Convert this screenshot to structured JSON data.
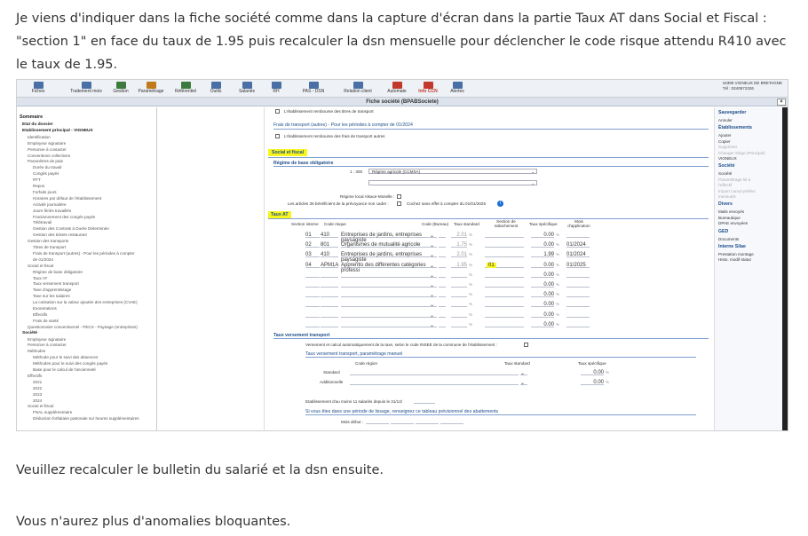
{
  "message": {
    "p1": "Je viens d'indiquer dans la fiche société comme  dans la capture d'écran dans la partie Taux AT dans Social et Fiscal : \"section 1\" en face du taux de 1.95 puis recalculer la dsn mensuelle pour déclencher le code risque attendu R410 avec le taux de 1.95.",
    "p2": "Veuillez recalculer le bulletin du salarié et la dsn ensuite.",
    "p3": "Vous n'aurez plus d'anomalies bloquantes."
  },
  "colors": {
    "highlight": "#f6f51d",
    "section_blue": "#1f4e8c",
    "toolbar_bg": "#eef1f5"
  },
  "toolbar": {
    "items": [
      {
        "label": "Fiches",
        "icon": "cards-icon"
      },
      {
        "label": "Traitement mois",
        "icon": "wrench-icon"
      },
      {
        "label": "Gestion",
        "icon": "folder-icon"
      },
      {
        "label": "Paramétrage",
        "icon": "gear-icon"
      },
      {
        "label": "Référentiel",
        "icon": "book-icon"
      },
      {
        "label": "Outils",
        "icon": "tools-icon"
      },
      {
        "label": "Salariés",
        "icon": "people-icon"
      },
      {
        "label": "RH",
        "icon": "rh-icon"
      },
      {
        "label": "PAS - DSN",
        "icon": "dsn-icon"
      },
      {
        "label": "Relation client",
        "icon": "headset-icon"
      },
      {
        "label": "Automate",
        "icon": "robot-icon"
      },
      {
        "label": "Info CCN",
        "icon": "info-icon"
      },
      {
        "label": "Alertes",
        "icon": "bell-icon"
      }
    ],
    "address": [
      "44390 VIGNEUX DE BRETAGNE",
      "Tél : 0240572326"
    ]
  },
  "window_title": "Fiche société (BPABSociete)",
  "left_nav": {
    "title": "Sommaire",
    "items": [
      {
        "t": "Etat du dossier",
        "lvl": 1
      },
      {
        "t": "Etablissement principal - VIGNEUX",
        "lvl": 1
      },
      {
        "t": "Identification",
        "lvl": 2
      },
      {
        "t": "Employeur signataire",
        "lvl": 2
      },
      {
        "t": "Personne à contacter",
        "lvl": 2
      },
      {
        "t": "Conventions collectives",
        "lvl": 2
      },
      {
        "t": "Paramètres de paie",
        "lvl": 2
      },
      {
        "t": "Durée du travail",
        "lvl": 3
      },
      {
        "t": "Congés payés",
        "lvl": 3
      },
      {
        "t": "RTT",
        "lvl": 3
      },
      {
        "t": "Repos",
        "lvl": 3
      },
      {
        "t": "Forfaits jours",
        "lvl": 3
      },
      {
        "t": "Horaires par défaut de l'établissement",
        "lvl": 3
      },
      {
        "t": "Activité journalière",
        "lvl": 3
      },
      {
        "t": "Jours fériés travaillés",
        "lvl": 3
      },
      {
        "t": "Fractionnement des congés payés",
        "lvl": 3
      },
      {
        "t": "Télétravail",
        "lvl": 3
      },
      {
        "t": "Gestion des Contrats à Durée Déterminée",
        "lvl": 3
      },
      {
        "t": "Gestion des tickets restaurant",
        "lvl": 3
      },
      {
        "t": "Gestion des transports",
        "lvl": 2
      },
      {
        "t": "Titres de transport",
        "lvl": 3
      },
      {
        "t": "Frais de transport (autres) - Pour les périodes à compter",
        "lvl": 3
      },
      {
        "t": "de 01/2024",
        "lvl": 3
      },
      {
        "t": "Social et fiscal",
        "lvl": 2
      },
      {
        "t": "Régime de base obligatoire",
        "lvl": 3
      },
      {
        "t": "Taux AT",
        "lvl": 3
      },
      {
        "t": "Taux versement transport",
        "lvl": 3
      },
      {
        "t": "Taxe d'apprentissage",
        "lvl": 3
      },
      {
        "t": "Taxe sur les salaires",
        "lvl": 3
      },
      {
        "t": "La cotisation sur la valeur ajoutée des entreprises (CVAE)",
        "lvl": 3
      },
      {
        "t": "Exonérations",
        "lvl": 3
      },
      {
        "t": "Effectifs",
        "lvl": 3
      },
      {
        "t": "Frais de santé",
        "lvl": 3
      },
      {
        "t": "Questionnaire conventionnel - PECS - Paysage (entreprises)",
        "lvl": 2
      },
      {
        "t": "Société",
        "lvl": 1
      },
      {
        "t": "Employeur signataire",
        "lvl": 2
      },
      {
        "t": "Personne à contacter",
        "lvl": 2
      },
      {
        "t": "Méthodes",
        "lvl": 2
      },
      {
        "t": "Méthode pour le suivi des absences",
        "lvl": 3
      },
      {
        "t": "Méthodes pour le suivi des congés payés",
        "lvl": 3
      },
      {
        "t": "Base pour le calcul de l'ancienneté",
        "lvl": 3
      },
      {
        "t": "Effectifs",
        "lvl": 2
      },
      {
        "t": "2021",
        "lvl": 3
      },
      {
        "t": "2022",
        "lvl": 3
      },
      {
        "t": "2023",
        "lvl": 3
      },
      {
        "t": "2024",
        "lvl": 3
      },
      {
        "t": "Social et fiscal",
        "lvl": 2
      },
      {
        "t": "FNAL supplémentaire",
        "lvl": 3
      },
      {
        "t": "Déduction forfaitaire patronale sur heures supplémentaires",
        "lvl": 3
      }
    ]
  },
  "form": {
    "cb1": "L'établissement rembourse des titres de transport",
    "sec_frais": "Frais de transport (autres) - Pour les périodes à compter de 01/2024",
    "cb2": "L'établissement rembourse des frais de transport autres",
    "sec_social": "Social et fiscal",
    "sec_regime": "Régime de base obligatoire",
    "regime_code": "1 : 300",
    "regime_value": "Régime agricole (CCMSA)",
    "alsace": "Régime local Alsace-Moselle :",
    "articles": "Les articles 36 bénéficient de la prévoyance non cadre :",
    "cochez": "Cochez sans effet à compter du 01/01/2025",
    "sec_taux_at": "Taux AT",
    "cols": [
      "Section interne",
      "Code risque",
      "Code (Bureau)",
      "Taux standard",
      "Section de rattachement",
      "Taux spécifique",
      "Mois d'application"
    ],
    "rows": [
      {
        "sec": "01",
        "code": "410",
        "lib": "Entreprises de jardins, entreprises paysagiste",
        "std": "2.01",
        "rat": "",
        "spec": "0.00",
        "mois": ""
      },
      {
        "sec": "02",
        "code": "801",
        "lib": "Organismes de mutualité agricole",
        "std": "1.75",
        "rat": "",
        "spec": "0.00",
        "mois": "01/2024"
      },
      {
        "sec": "03",
        "code": "410",
        "lib": "Entreprises de jardins, entreprises paysagiste",
        "std": "2.01",
        "rat": "",
        "spec": "1.99",
        "mois": "01/2024"
      },
      {
        "sec": "04",
        "code": "APM1A",
        "lib": "Apprentis des différentes catégories professi",
        "std": "1.95",
        "rat": "01",
        "spec": "0.00",
        "mois": "01/2025"
      },
      {
        "spec": "0.00"
      },
      {
        "spec": "0.00"
      },
      {
        "spec": "0.00"
      },
      {
        "spec": "0.00"
      },
      {
        "spec": "0.00"
      },
      {
        "spec": "0.00"
      }
    ],
    "pct": "%",
    "sec_vt": "Taux versement transport",
    "vt_cb": "Versement et calcul automatiquement de la taxe, selon le code INSEE de la commune de l'établissement :",
    "sec_vt_manuel": "Taux versement transport, paramétrage manuel",
    "vt_cols": [
      "Code région",
      "Taux standard",
      "Taux spécifique"
    ],
    "vt_rows": [
      {
        "lib": "Standard",
        "spec": "0.00"
      },
      {
        "lib": "Additionnelle",
        "spec": "0.00"
      }
    ],
    "etab11": "Etablissement d'au moins 11 salariés depuis le 31/12/",
    "sec_lissage": "Si vous êtes dans une période de lissage, renseignez ce tableau prévisionnel des abattements",
    "mois_debut": "Mois début :"
  },
  "right_panel": {
    "items": [
      {
        "t": "Sauvegarder",
        "type": "h"
      },
      {
        "t": "Annuler",
        "type": "n"
      },
      {
        "t": "Établissements",
        "type": "h"
      },
      {
        "t": "Ajouter",
        "type": "n"
      },
      {
        "t": "Copier",
        "type": "n"
      },
      {
        "t": "Supprimer",
        "type": "dim"
      },
      {
        "t": "Changer Siège (Principal)",
        "type": "dim"
      },
      {
        "t": "VIGNEUX",
        "type": "n"
      },
      {
        "t": "Société",
        "type": "h"
      },
      {
        "t": "Société",
        "type": "n"
      },
      {
        "t": "Paramétrage lié à",
        "type": "dim"
      },
      {
        "t": "l'effectif",
        "type": "dim"
      },
      {
        "t": "Import cumul prélèvt",
        "type": "dim"
      },
      {
        "t": "mensuels",
        "type": "dim"
      },
      {
        "t": "Divers",
        "type": "h"
      },
      {
        "t": "Mails envoyés",
        "type": "n"
      },
      {
        "t": "Bureautique",
        "type": "n"
      },
      {
        "t": "DPAE envoyées",
        "type": "n"
      },
      {
        "t": "GED",
        "type": "h"
      },
      {
        "t": "Documents",
        "type": "n"
      },
      {
        "t": "Interne Silae",
        "type": "h"
      },
      {
        "t": "Prestation montage",
        "type": "n"
      },
      {
        "t": "Histo. modif statut",
        "type": "n"
      }
    ]
  }
}
